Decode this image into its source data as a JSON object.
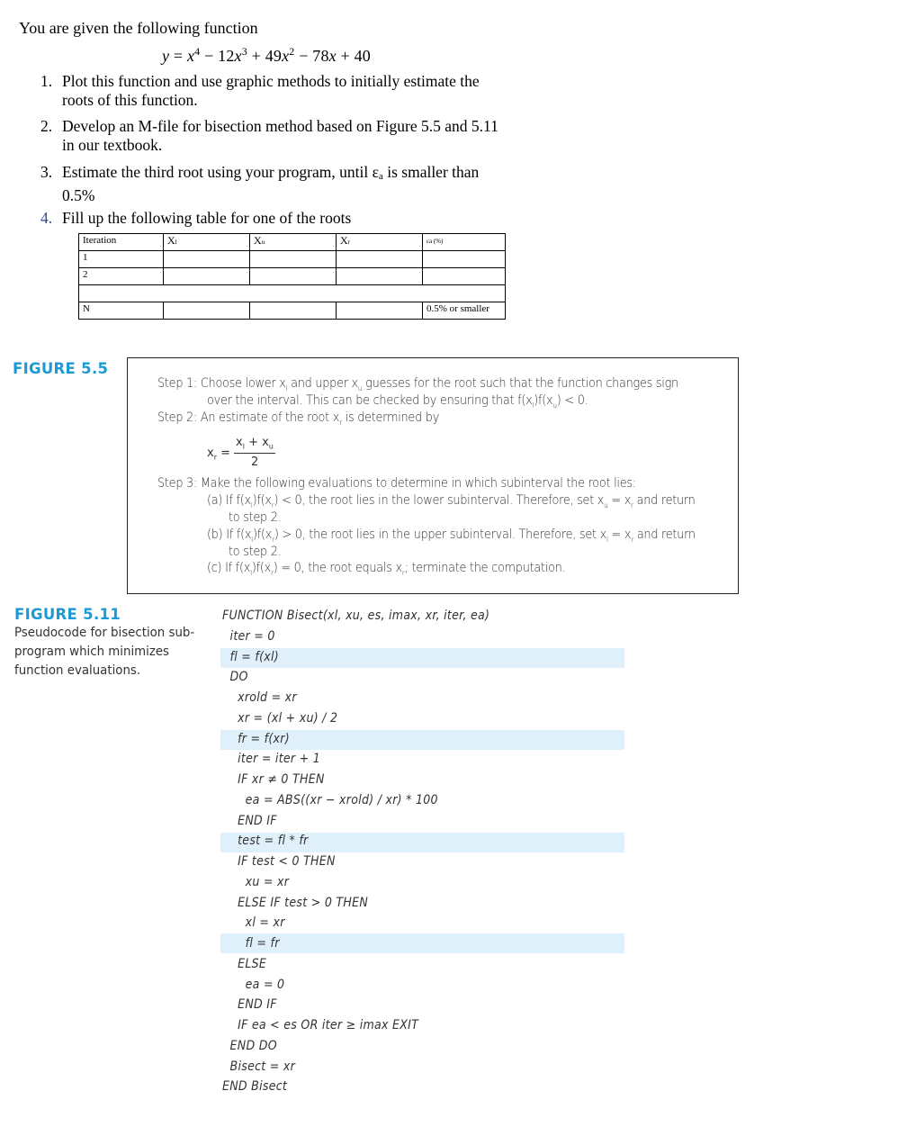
{
  "intro": "You are given the following function",
  "equation": {
    "y": "y",
    "eq": " = ",
    "t1": "x",
    "t1_exp": "4",
    "op1": " − 12",
    "t2": "x",
    "t2_exp": "3",
    "op2": " + 49",
    "t3": "x",
    "t3_exp": "2",
    "op3": " − 78",
    "t4": "x",
    "op4": " + 40"
  },
  "tasks": [
    {
      "num": "1.",
      "lines": [
        "Plot this function and use graphic methods to initially estimate the",
        "roots of this function."
      ]
    },
    {
      "num": "2.",
      "lines": [
        "Develop an M-file for bisection method based on Figure 5.5 and 5.11",
        "in our textbook."
      ]
    },
    {
      "num": "3.",
      "lines_prefix": "Estimate the third root using your program, until ε",
      "sub": "a",
      "lines_suffix": " is smaller than",
      "line2": "0.5%"
    },
    {
      "num": "4.",
      "lines": [
        "Fill up the following table for one of the roots"
      ]
    }
  ],
  "table": {
    "headers": [
      "Iteration",
      "X",
      "X",
      "X",
      "ε"
    ],
    "header_subs": [
      "",
      "l",
      "u",
      "r",
      "a (%)"
    ],
    "rows": [
      [
        "1",
        "",
        "",
        "",
        ""
      ],
      [
        "2",
        "",
        "",
        "",
        ""
      ],
      [
        "",
        "",
        "",
        "",
        ""
      ],
      [
        "N",
        "",
        "",
        "",
        "0.5% or smaller"
      ]
    ]
  },
  "figure55": {
    "label": "FIGURE 5.5",
    "step1a": "Step 1: Choose lower x",
    "step1b": " and upper x",
    "step1c": " guesses for the root such that the function changes sign",
    "step1_line2": "over the interval. This can be checked by ensuring that f(x",
    "step1_line2b": ")f(x",
    "step1_line2c": ") < 0.",
    "step2": "Step 2: An estimate of the root x",
    "step2b": " is determined by",
    "formula_lhs": "x",
    "formula_num": "x",
    "formula_plus": " + x",
    "formula_den": "2",
    "step3": "Step 3: Make the following evaluations to determine in which subinterval the root lies:",
    "a1": "(a) If f(x",
    "a2": ")f(x",
    "a3": ") < 0, the root lies in the lower subinterval. Therefore, set x",
    "a4": " = x",
    "a5": " and return",
    "a_line2": "to step 2.",
    "b1": "(b) If f(x",
    "b2": ")f(x",
    "b3": ") > 0, the root lies in the upper subinterval. Therefore, set x",
    "b4": " = x",
    "b5": " and return",
    "b_line2": "to step 2.",
    "c1": "(c) If f(x",
    "c2": ")f(x",
    "c3": ") = 0, the root equals x",
    "c4": "; terminate the computation.",
    "sub_l": "l",
    "sub_u": "u",
    "sub_r": "r"
  },
  "figure511": {
    "label": "FIGURE 5.11",
    "caption": [
      "Pseudocode for bisection sub-",
      "program which minimizes",
      "function evaluations."
    ],
    "code": [
      "FUNCTION Bisect(xl, xu, es, imax, xr, iter, ea)",
      "  iter = 0",
      "  fl = f(xl)",
      "  DO",
      "    xrold = xr",
      "    xr = (xl + xu) / 2",
      "    fr = f(xr)",
      "    iter = iter + 1",
      "    IF xr ≠ 0 THEN",
      "      ea = ABS((xr − xrold) / xr) * 100",
      "    END IF",
      "    test = fl * fr",
      "    IF test < 0 THEN",
      "      xu = xr",
      "    ELSE IF test > 0 THEN",
      "      xl = xr",
      "      fl = fr",
      "    ELSE",
      "      ea = 0",
      "    END IF",
      "    IF ea < es OR iter ≥ imax EXIT",
      "  END DO",
      "  Bisect = xr",
      "END Bisect"
    ],
    "highlight_color": "#dff0fb"
  },
  "colors": {
    "figure_label": "#1a9ad6",
    "task4_number": "#2b4a8b"
  }
}
